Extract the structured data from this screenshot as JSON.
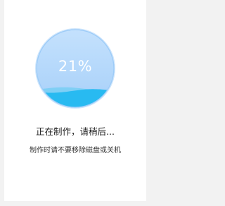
{
  "progress": {
    "percent_label": "21%",
    "value": 0.21
  },
  "status_text": "正在制作，请稍后...",
  "warning_text": "制作时请不要移除磁盘或关机",
  "colors": {
    "background": "#f2f2f2",
    "panel": "#ffffff",
    "gauge_fill": "#b4d8fc",
    "gauge_rim": "#8ec3f6",
    "wave_front": "#28baf1",
    "wave_back": "#7fcff5",
    "label": "#1a1a1a"
  }
}
